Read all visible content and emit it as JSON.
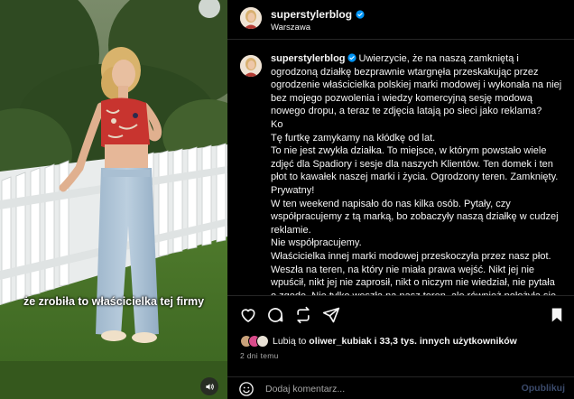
{
  "post": {
    "username": "superstylerblog",
    "location": "Warszawa",
    "verified_icon": "verified-badge-icon",
    "caption_intro": "Uwierzycie, że na naszą zamkniętą i ogrodzoną działkę bezprawnie wtargnęła przeskakując przez ogrodzenie właścicielka polskiej marki modowej i wykonała na niej bez mojego pozwolenia i wiedzy komercyjną sesję modową nowego dropu, a teraz te zdjęcia latają po sieci jako reklama?",
    "caption_rest": "Ko\nTę furtkę zamykamy na kłódkę od lat.\nTo nie jest zwykła działka. To miejsce, w którym powstało wiele zdjęć dla Spadiory i sesje dla naszych Klientów. Ten domek i ten płot to kawałek naszej marki i życia. Ogrodzony teren. Zamknięty. Prywatny!\nW ten weekend napisało do nas kilka osób. Pytały, czy współpracujemy z tą marką, bo zobaczyły naszą działkę w cudzej reklamie.\nNie współpracujemy.\nWłaścicielka innej marki modowej przeskoczyła przez nasz płot. Weszła na teren, na który nie miała prawa wejść. Nikt jej nie wpuścił, nikt jej nie zaprosił, nikt o niczym nie wiedział, nie pytała o zgodę. Nie tylko weszła na nasz teren, ale również położyła się"
  },
  "video": {
    "subtitle": "że zrobiła to właścicielka tej firmy",
    "sound_icon": "speaker-icon"
  },
  "actions": {
    "like_icon": "heart-icon",
    "comment_icon": "comment-icon",
    "share_icon": "repost-icon",
    "send_icon": "send-icon",
    "save_icon": "bookmark-icon"
  },
  "likes": {
    "prefix": "Lubią to",
    "user": "oliwer_kubiak",
    "suffix": "i 33,3 tys. innych użytkowników"
  },
  "time_ago": "2 dni temu",
  "comment": {
    "placeholder": "Dodaj komentarz...",
    "publish_label": "Opublikuj"
  },
  "colors": {
    "background": "#000000",
    "text": "#f5f5f5",
    "secondary_text": "#a8a8a8",
    "verified": "#0095f6",
    "publish_disabled": "#3b4a6b"
  }
}
